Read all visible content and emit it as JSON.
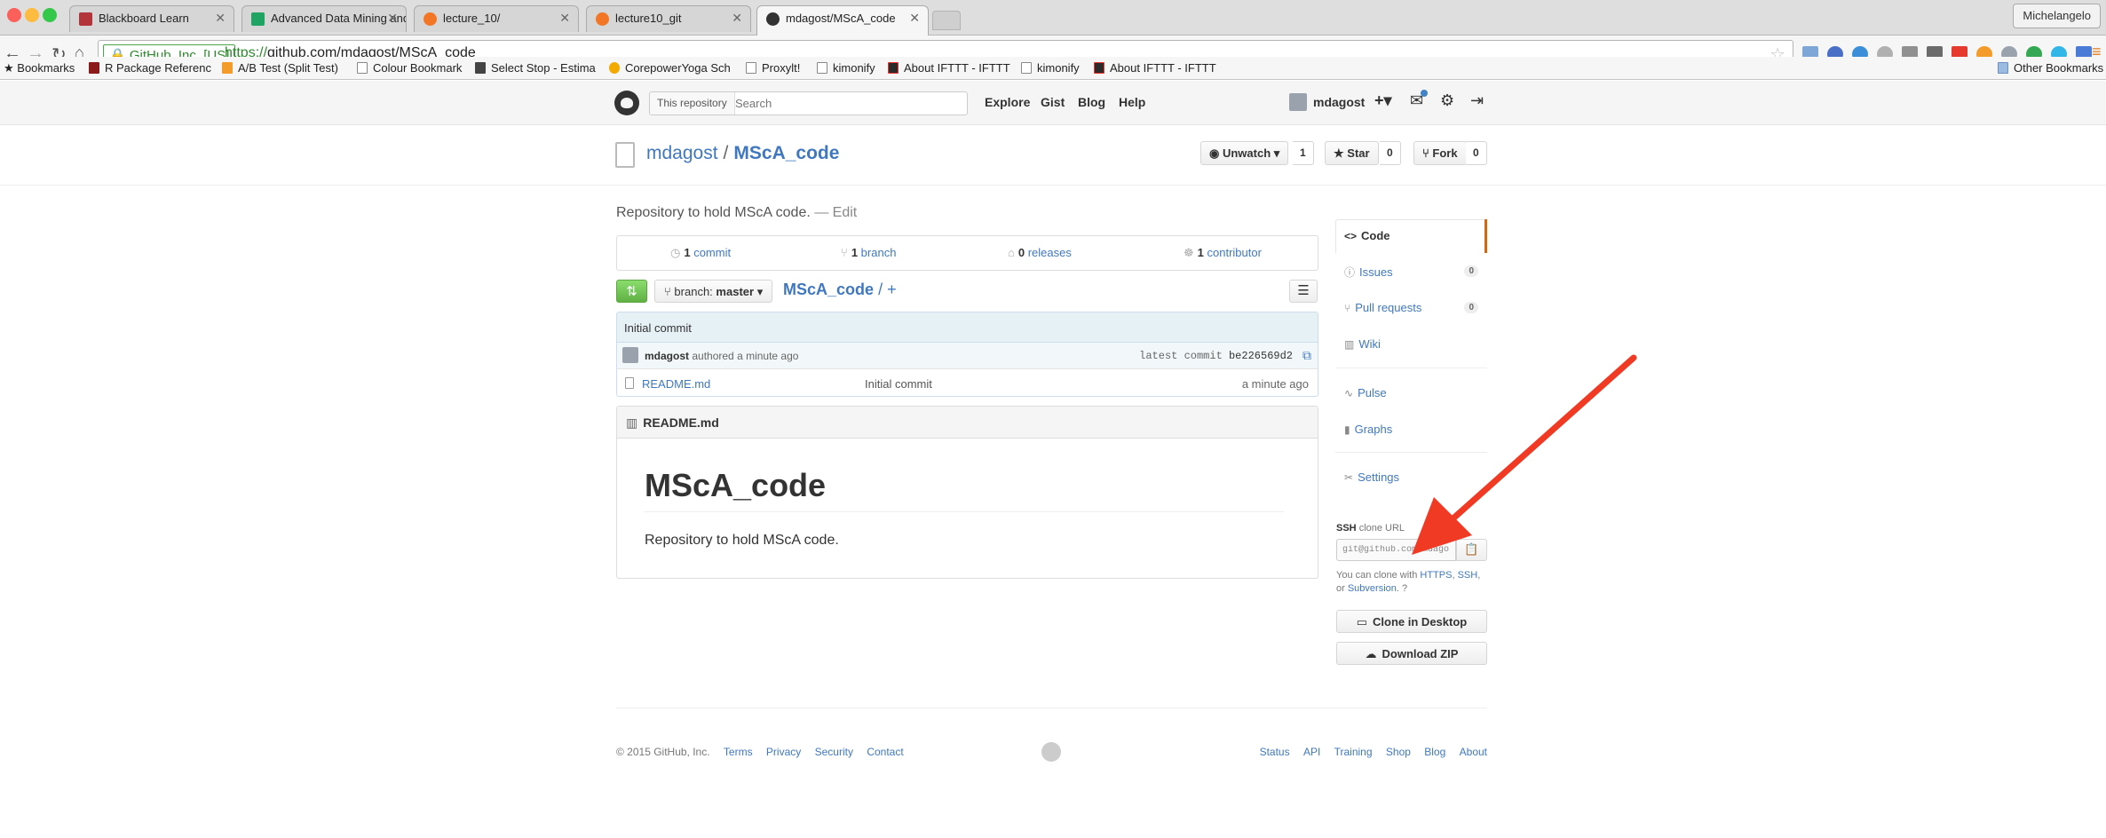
{
  "browser": {
    "tabs": [
      {
        "label": "Blackboard Learn",
        "favicon_color": "#b3343a"
      },
      {
        "label": "Advanced Data Mining and",
        "favicon_color": "#1fa463"
      },
      {
        "label": "lecture_10/",
        "favicon_color": "#f37626"
      },
      {
        "label": "lecture10_git",
        "favicon_color": "#f37626"
      },
      {
        "label": "mdagost/MScA_code",
        "favicon_color": "#333333"
      }
    ],
    "profile": "Michelangelo",
    "ev_badge": "GitHub, Inc. [US]",
    "url_scheme": "https://",
    "url_rest": "github.com/mdagost/MScA_code",
    "bookmarks": [
      "Bookmarks",
      "R Package Referenc",
      "A/B Test (Split Test)",
      "Colour Bookmark",
      "Select Stop - Estima",
      "CorepowerYoga Sch",
      "Proxylt!",
      "kimonify",
      "About IFTTT - IFTTT",
      "kimonify",
      "About IFTTT - IFTTT"
    ],
    "other_bookmarks": "Other Bookmarks"
  },
  "gh_header": {
    "scope": "This repository",
    "search_placeholder": "Search",
    "nav": [
      "Explore",
      "Gist",
      "Blog",
      "Help"
    ],
    "username": "mdagost",
    "icons": [
      "plus-icon",
      "notifications-icon",
      "settings-icon",
      "sign-out-icon"
    ]
  },
  "repo": {
    "owner": "mdagost",
    "separator": "/",
    "name": "MScA_code",
    "unwatch_label": "Unwatch",
    "watch_count": "1",
    "star_label": "Star",
    "star_count": "0",
    "fork_label": "Fork",
    "fork_count": "0",
    "description": "Repository to hold MScA code.",
    "edit_label": "— Edit"
  },
  "numbers": [
    {
      "value": "1",
      "label": "commit",
      "icon": "history-icon"
    },
    {
      "value": "1",
      "label": "branch",
      "icon": "branch-icon"
    },
    {
      "value": "0",
      "label": "releases",
      "icon": "tag-icon"
    },
    {
      "value": "1",
      "label": "contributor",
      "icon": "organization-icon"
    }
  ],
  "file_nav": {
    "branch_prefix": "branch:",
    "branch": "master",
    "breadcrumb_repo": "MScA_code",
    "breadcrumb_sep": "/",
    "breadcrumb_add": "+"
  },
  "commit": {
    "title": "Initial commit",
    "author": "mdagost",
    "authored": "authored a minute ago",
    "latest_label": "latest commit",
    "sha": "be226569d2"
  },
  "files": [
    {
      "name": "README.md",
      "message": "Initial commit",
      "age": "a minute ago"
    }
  ],
  "readme": {
    "header": "README.md",
    "h1": "MScA_code",
    "body": "Repository to hold MScA code."
  },
  "sidebar": {
    "items": [
      {
        "label": "Code",
        "icon": "code-icon",
        "count": ""
      },
      {
        "label": "Issues",
        "icon": "issue-icon",
        "count": "0"
      },
      {
        "label": "Pull requests",
        "icon": "pull-request-icon",
        "count": "0"
      },
      {
        "label": "Wiki",
        "icon": "book-icon",
        "count": ""
      },
      {
        "label": "Pulse",
        "icon": "pulse-icon",
        "count": ""
      },
      {
        "label": "Graphs",
        "icon": "graph-icon",
        "count": ""
      },
      {
        "label": "Settings",
        "icon": "tools-icon",
        "count": ""
      }
    ],
    "clone_proto": "SSH",
    "clone_label": "clone URL",
    "clone_url": "git@github.com:mdagost/MScA_code.git",
    "clone_help_prefix": "You can clone with",
    "clone_help_https": "HTTPS",
    "clone_help_ssh": "SSH",
    "clone_help_or": "or",
    "clone_help_svn": "Subversion",
    "clone_desktop": "Clone in Desktop",
    "download_zip": "Download ZIP"
  },
  "annotation": {
    "arrow_color": "#f03a24"
  },
  "footer": {
    "copyright": "© 2015 GitHub, Inc.",
    "left_links": [
      "Terms",
      "Privacy",
      "Security",
      "Contact"
    ],
    "right_links": [
      "Status",
      "API",
      "Training",
      "Shop",
      "Blog",
      "About"
    ]
  }
}
